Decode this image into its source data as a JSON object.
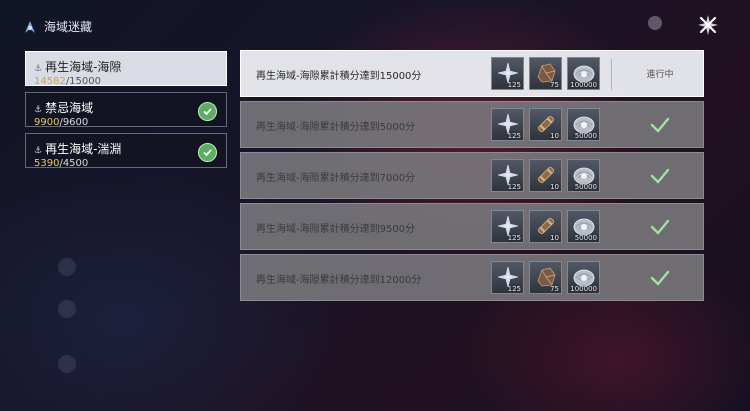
{
  "header": {
    "title": "海域迷藏"
  },
  "zones": [
    {
      "name": "再生海域-海隙",
      "current": "14582",
      "max": "/15000",
      "completed": false,
      "selected": true
    },
    {
      "name": "禁忌海域",
      "current": "9900",
      "max": "/9600",
      "completed": true,
      "selected": false
    },
    {
      "name": "再生海域-湍淵",
      "current": "5390",
      "max": "/4500",
      "completed": true,
      "selected": false
    }
  ],
  "missions": [
    {
      "text": "再生海域-海隙累計積分達到15000分",
      "status": "進行中",
      "done": false,
      "rewards": [
        {
          "icon": "star-shard-icon",
          "qty": "125"
        },
        {
          "icon": "ore-chunk-icon",
          "qty": "75"
        },
        {
          "icon": "pearl-shell-icon",
          "qty": "100000"
        }
      ]
    },
    {
      "text": "再生海域-海隙累計積分達到5000分",
      "status": "",
      "done": true,
      "rewards": [
        {
          "icon": "star-shard-icon",
          "qty": "125"
        },
        {
          "icon": "scroll-tube-icon",
          "qty": "10"
        },
        {
          "icon": "pearl-shell-icon",
          "qty": "50000"
        }
      ]
    },
    {
      "text": "再生海域-海隙累計積分達到7000分",
      "status": "",
      "done": true,
      "rewards": [
        {
          "icon": "star-shard-icon",
          "qty": "125"
        },
        {
          "icon": "scroll-tube-icon",
          "qty": "10"
        },
        {
          "icon": "pearl-shell-icon",
          "qty": "50000"
        }
      ]
    },
    {
      "text": "再生海域-海隙累計積分達到9500分",
      "status": "",
      "done": true,
      "rewards": [
        {
          "icon": "star-shard-icon",
          "qty": "125"
        },
        {
          "icon": "scroll-tube-icon",
          "qty": "10"
        },
        {
          "icon": "pearl-shell-icon",
          "qty": "50000"
        }
      ]
    },
    {
      "text": "再生海域-海隙累計積分達到12000分",
      "status": "",
      "done": true,
      "rewards": [
        {
          "icon": "star-shard-icon",
          "qty": "125"
        },
        {
          "icon": "ore-chunk-icon",
          "qty": "75"
        },
        {
          "icon": "pearl-shell-icon",
          "qty": "100000"
        }
      ]
    }
  ],
  "colors": {
    "accent_gold": "#e4c66a",
    "check_green": "#5cae63",
    "row_active": "#eceef3",
    "row_done": "#7d7d80"
  }
}
